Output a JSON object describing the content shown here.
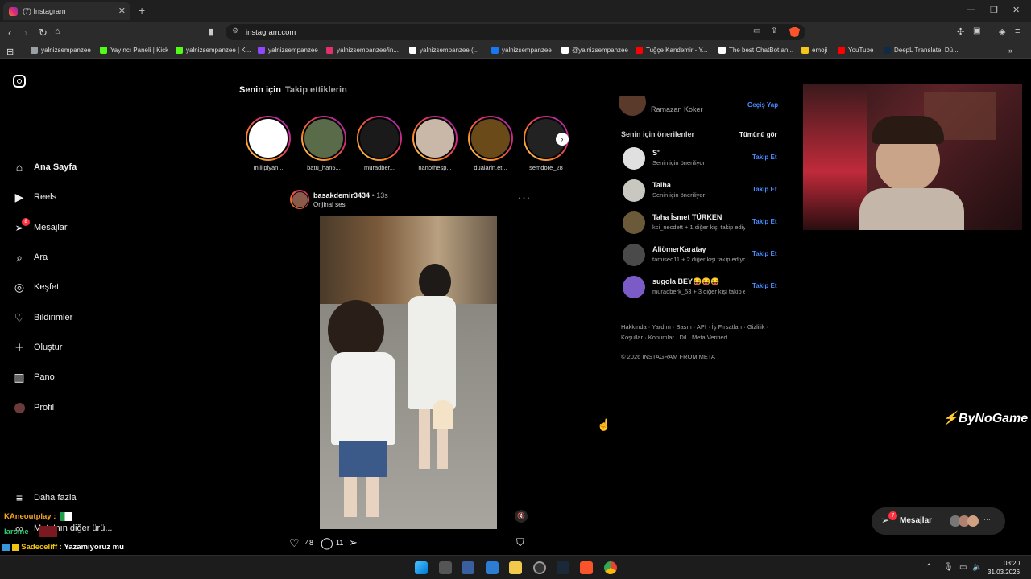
{
  "browser": {
    "tab_title": "(7) Instagram",
    "url": "instagram.com",
    "bookmarks": [
      {
        "label": "yalnizsempanzee",
        "color": "#9aa0a6"
      },
      {
        "label": "Yayıncı Paneli | Kick",
        "color": "#53fc18"
      },
      {
        "label": "yalnizsempanzee | K...",
        "color": "#53fc18"
      },
      {
        "label": "yalnizsempanzee",
        "color": "#9146ff"
      },
      {
        "label": "yalnizsempanzee/in...",
        "color": "#e1306c"
      },
      {
        "label": "yalnizsempanzee (...",
        "color": "#ffffff"
      },
      {
        "label": "yalnizsempanzee",
        "color": "#1877f2"
      },
      {
        "label": "@yalnizsempanzee",
        "color": "#ffffff"
      },
      {
        "label": "Tuğçe Kandemir - Y...",
        "color": "#ff0000"
      },
      {
        "label": "The best ChatBot an...",
        "color": "#ffffff"
      },
      {
        "label": "emoji",
        "color": "#f5c518"
      },
      {
        "label": "YouTube",
        "color": "#ff0000"
      },
      {
        "label": "DeepL Translate: Dü...",
        "color": "#0f2b46"
      }
    ]
  },
  "sidebar": {
    "items": [
      {
        "label": "Ana Sayfa",
        "icon": "home-icon"
      },
      {
        "label": "Reels",
        "icon": "reels-icon"
      },
      {
        "label": "Mesajlar",
        "icon": "messages-icon",
        "badge": "8"
      },
      {
        "label": "Ara",
        "icon": "search-icon"
      },
      {
        "label": "Keşfet",
        "icon": "explore-icon"
      },
      {
        "label": "Bildirimler",
        "icon": "heart-icon"
      },
      {
        "label": "Oluştur",
        "icon": "plus-icon"
      },
      {
        "label": "Pano",
        "icon": "dashboard-icon"
      },
      {
        "label": "Profil",
        "icon": "avatar"
      }
    ],
    "more": "Daha fazla",
    "partial_item": "Meta'nın diğer ürü..."
  },
  "feed": {
    "tabs": [
      "Senin için",
      "Takip ettiklerin"
    ],
    "stories": [
      {
        "name": "millipiyan...",
        "color": "#ffffff"
      },
      {
        "name": "batu_han5...",
        "color": "#5a6b4a"
      },
      {
        "name": "muradber...",
        "color": "#1a1a1a"
      },
      {
        "name": "nanothesp...",
        "color": "#c9b8a8"
      },
      {
        "name": "dualarin.et...",
        "color": "#6b4a1a"
      },
      {
        "name": "semdore_28",
        "color": "#222222"
      }
    ],
    "post": {
      "username": "basakdemir3434",
      "time": "13s",
      "audio": "Orijinal ses",
      "likes": "48",
      "comments": "11"
    }
  },
  "right": {
    "current_user": "Ramazan Koker",
    "switch": "Geçiş Yap",
    "suggestions_title": "Senin için önerilenler",
    "see_all": "Tümünü gör",
    "follow_label": "Takip Et",
    "suggestions": [
      {
        "name": "S''",
        "sub": "Senin için öneriliyor",
        "color": "#e0e0e0"
      },
      {
        "name": "Talha",
        "sub": "Senin için öneriliyor",
        "color": "#c8c8c0"
      },
      {
        "name": "Taha İsmet TÜRKEN",
        "sub": "kci_necdett + 1 diğer kişi takip ediyor",
        "color": "#6b5a3a"
      },
      {
        "name": "AliömerKaratay",
        "sub": "tamised11 + 2 diğer kişi takip ediyor",
        "color": "#4a4a4a"
      },
      {
        "name": "sugola BEY😝😝😝",
        "sub": "muradberk_53 + 3 diğer kişi takip ediyor",
        "color": "#7b5cc7"
      }
    ],
    "footer_links1": "Hakkında · Yardım · Basın · API · İş Fırsatları · Gizlilik ·",
    "footer_links2": "Koşullar · Konumlar · Dil · Meta Verified",
    "copyright": "© 2026 INSTAGRAM FROM META"
  },
  "messages_pill": {
    "label": "Mesajlar",
    "badge": "7"
  },
  "overlay": {
    "brand": "ByNoGame",
    "chat": [
      {
        "user": "KAneoutplay :",
        "text": "",
        "color": "#f5a623"
      },
      {
        "user": "larsine",
        "text": "",
        "color": "#2ecc71"
      },
      {
        "user": "Sadeceliff :",
        "text": "Yazamıyoruz mu",
        "color": "#f1c40f"
      }
    ]
  },
  "taskbar": {
    "time": "03:20",
    "date": "31.03.2026"
  }
}
